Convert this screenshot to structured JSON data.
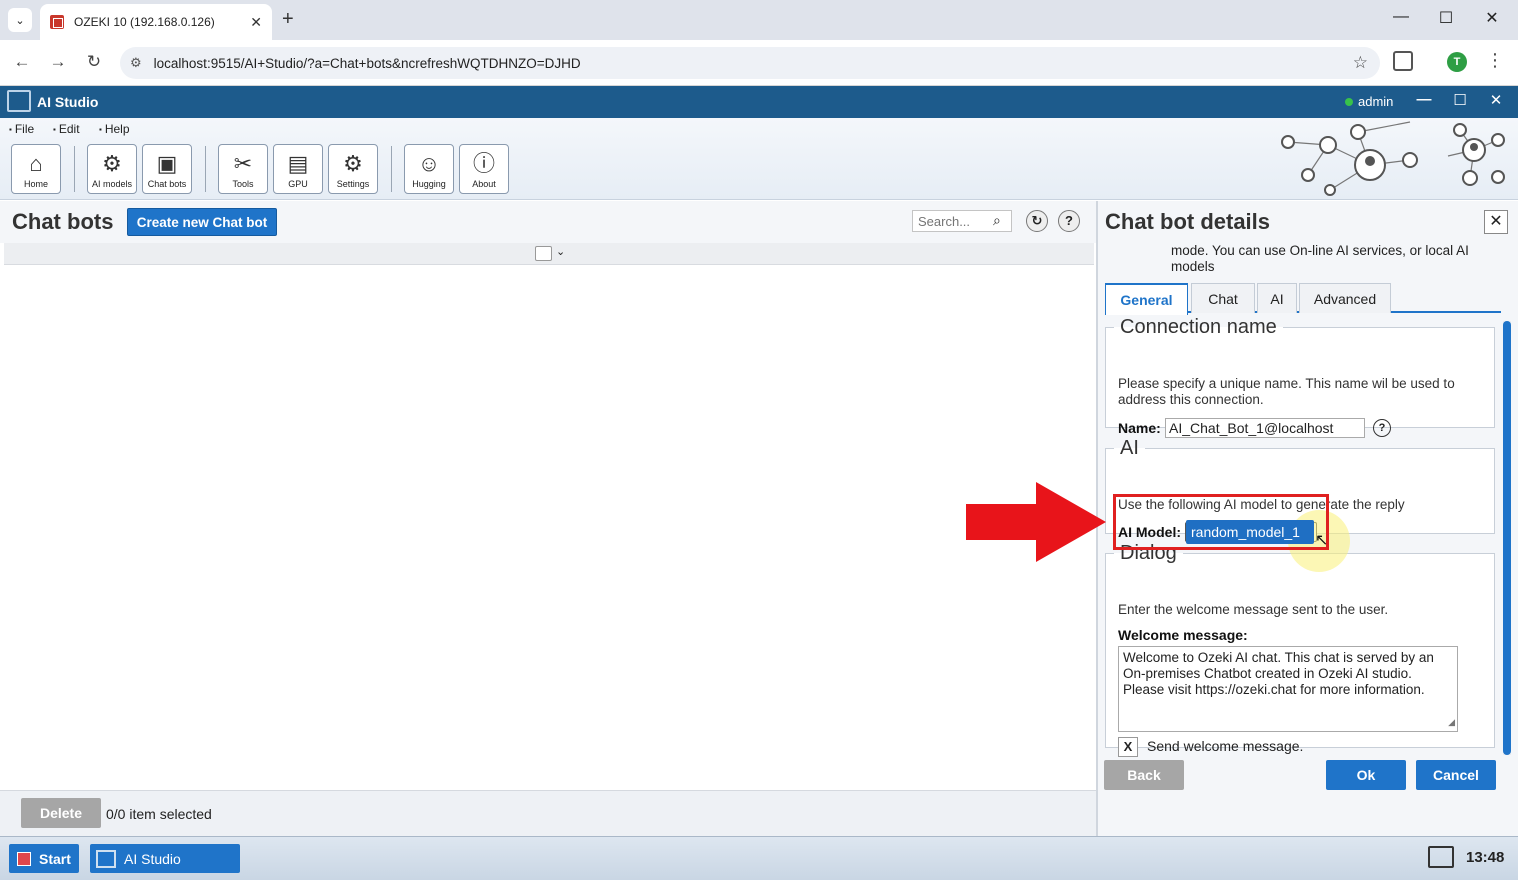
{
  "browser": {
    "tab_title": "OZEKI 10 (192.168.0.126)",
    "url": "localhost:9515/AI+Studio/?a=Chat+bots&ncrefreshWQTDHNZO=DJHD",
    "profile_initial": "T"
  },
  "app": {
    "title": "AI Studio",
    "user": "admin"
  },
  "menu": [
    "File",
    "Edit",
    "Help"
  ],
  "toolbar": {
    "home": "Home",
    "ai_models": "AI models",
    "chat_bots": "Chat bots",
    "tools": "Tools",
    "gpu": "GPU",
    "settings": "Settings",
    "hugging": "Hugging",
    "about": "About"
  },
  "left": {
    "title": "Chat bots",
    "create_button": "Create new Chat bot",
    "search_placeholder": "Search...",
    "delete_button": "Delete",
    "selection_status": "0/0 item selected"
  },
  "details": {
    "title": "Chat bot details",
    "intro": "mode. You can use On-line AI services, or local AI models",
    "tabs": [
      "General",
      "Chat",
      "AI",
      "Advanced"
    ],
    "active_tab": "General",
    "connection": {
      "legend": "Connection name",
      "description": "Please specify a unique name. This name wil be used to address this connection.",
      "name_label": "Name:",
      "name_value": "AI_Chat_Bot_1@localhost"
    },
    "ai": {
      "legend": "AI",
      "description": "Use the following AI model to generate the reply",
      "model_label": "AI Model:",
      "model_value": "random_model_1",
      "dropdown_option": "random_model_1"
    },
    "dialog": {
      "legend": "Dialog",
      "description": "Enter the welcome message sent to the user.",
      "welcome_label": "Welcome message:",
      "welcome_text": "Welcome to Ozeki AI chat. This chat is served by an On-premises Chatbot created in Ozeki AI studio. Please visit https://ozeki.chat for more information.",
      "send_checkbox_mark": "X",
      "send_label": "Send welcome message."
    },
    "back_button": "Back",
    "ok_button": "Ok",
    "cancel_button": "Cancel"
  },
  "taskbar": {
    "start": "Start",
    "app": "AI Studio",
    "clock": "13:48"
  },
  "colors": {
    "brand_blue": "#1d5b8c",
    "accent_blue": "#1f74c9",
    "highlight_red": "#e02020"
  }
}
